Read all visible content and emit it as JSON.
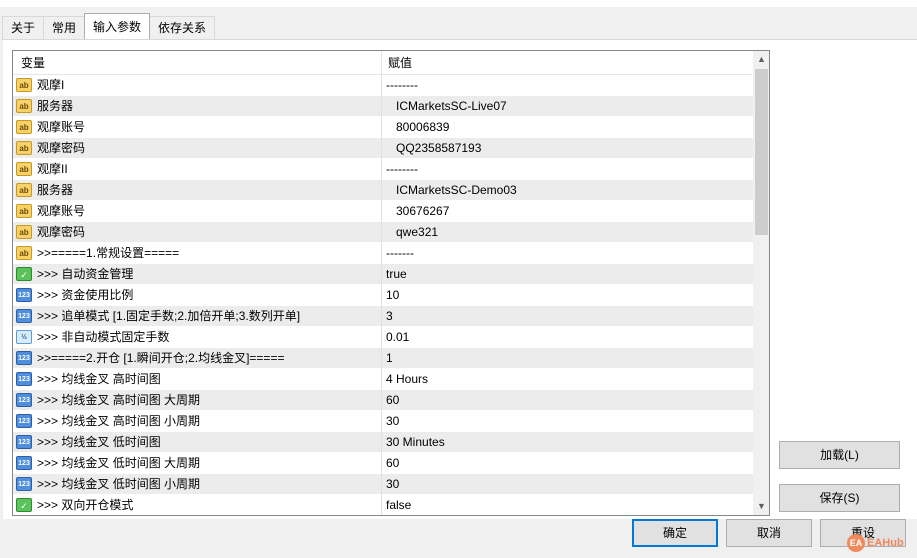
{
  "tabs": [
    {
      "label": "关于"
    },
    {
      "label": "常用"
    },
    {
      "label": "输入参数"
    },
    {
      "label": "依存关系"
    }
  ],
  "grid": {
    "col_variable": "变量",
    "col_value": "赋值",
    "rows": [
      {
        "icon": "ab",
        "name": "观摩I",
        "value": "--------"
      },
      {
        "icon": "ab",
        "name": "服务器",
        "value": "   ICMarketsSC-Live07"
      },
      {
        "icon": "ab",
        "name": "观摩账号",
        "value": "   80006839"
      },
      {
        "icon": "ab",
        "name": "观摩密码",
        "value": "   QQ2358587193"
      },
      {
        "icon": "ab",
        "name": "观摩II",
        "value": "--------"
      },
      {
        "icon": "ab",
        "name": "服务器",
        "value": "   ICMarketsSC-Demo03"
      },
      {
        "icon": "ab",
        "name": "观摩账号",
        "value": "   30676267"
      },
      {
        "icon": "ab",
        "name": "观摩密码",
        "value": "   qwe321"
      },
      {
        "icon": "ab",
        "name": ">>=====1.常规设置=====",
        "value": "-------"
      },
      {
        "icon": "bool",
        "name": ">>>  自动资金管理",
        "value": "true"
      },
      {
        "icon": "num",
        "name": ">>>  资金使用比例",
        "value": "10"
      },
      {
        "icon": "num",
        "name": ">>>  追单模式 [1.固定手数;2.加倍开单;3.数列开单]",
        "value": "3"
      },
      {
        "icon": "dbl",
        "name": ">>>  非自动模式固定手数",
        "value": "0.01"
      },
      {
        "icon": "num",
        "name": ">>=====2.开仓 [1.瞬间开仓;2.均线金叉]=====",
        "value": "1"
      },
      {
        "icon": "num",
        "name": ">>>  均线金叉 高时间图",
        "value": "4 Hours"
      },
      {
        "icon": "num",
        "name": ">>>  均线金叉 高时间图 大周期",
        "value": "60"
      },
      {
        "icon": "num",
        "name": ">>>  均线金叉 高时间图 小周期",
        "value": "30"
      },
      {
        "icon": "num",
        "name": ">>>  均线金叉 低时间图",
        "value": "30 Minutes"
      },
      {
        "icon": "num",
        "name": ">>>  均线金叉 低时间图 大周期",
        "value": "60"
      },
      {
        "icon": "num",
        "name": ">>>  均线金叉 低时间图 小周期",
        "value": "30"
      },
      {
        "icon": "bool",
        "name": ">>>  双向开仓模式",
        "value": "false"
      }
    ]
  },
  "icon_glyphs": {
    "ab": "ab",
    "num": "123",
    "bool": "✓",
    "dbl": "½"
  },
  "buttons": {
    "load": "加载(L)",
    "save": "保存(S)",
    "ok": "确定",
    "cancel": "取消",
    "reset": "重设"
  },
  "watermark": {
    "logo": "EA",
    "text": "EAHub"
  }
}
